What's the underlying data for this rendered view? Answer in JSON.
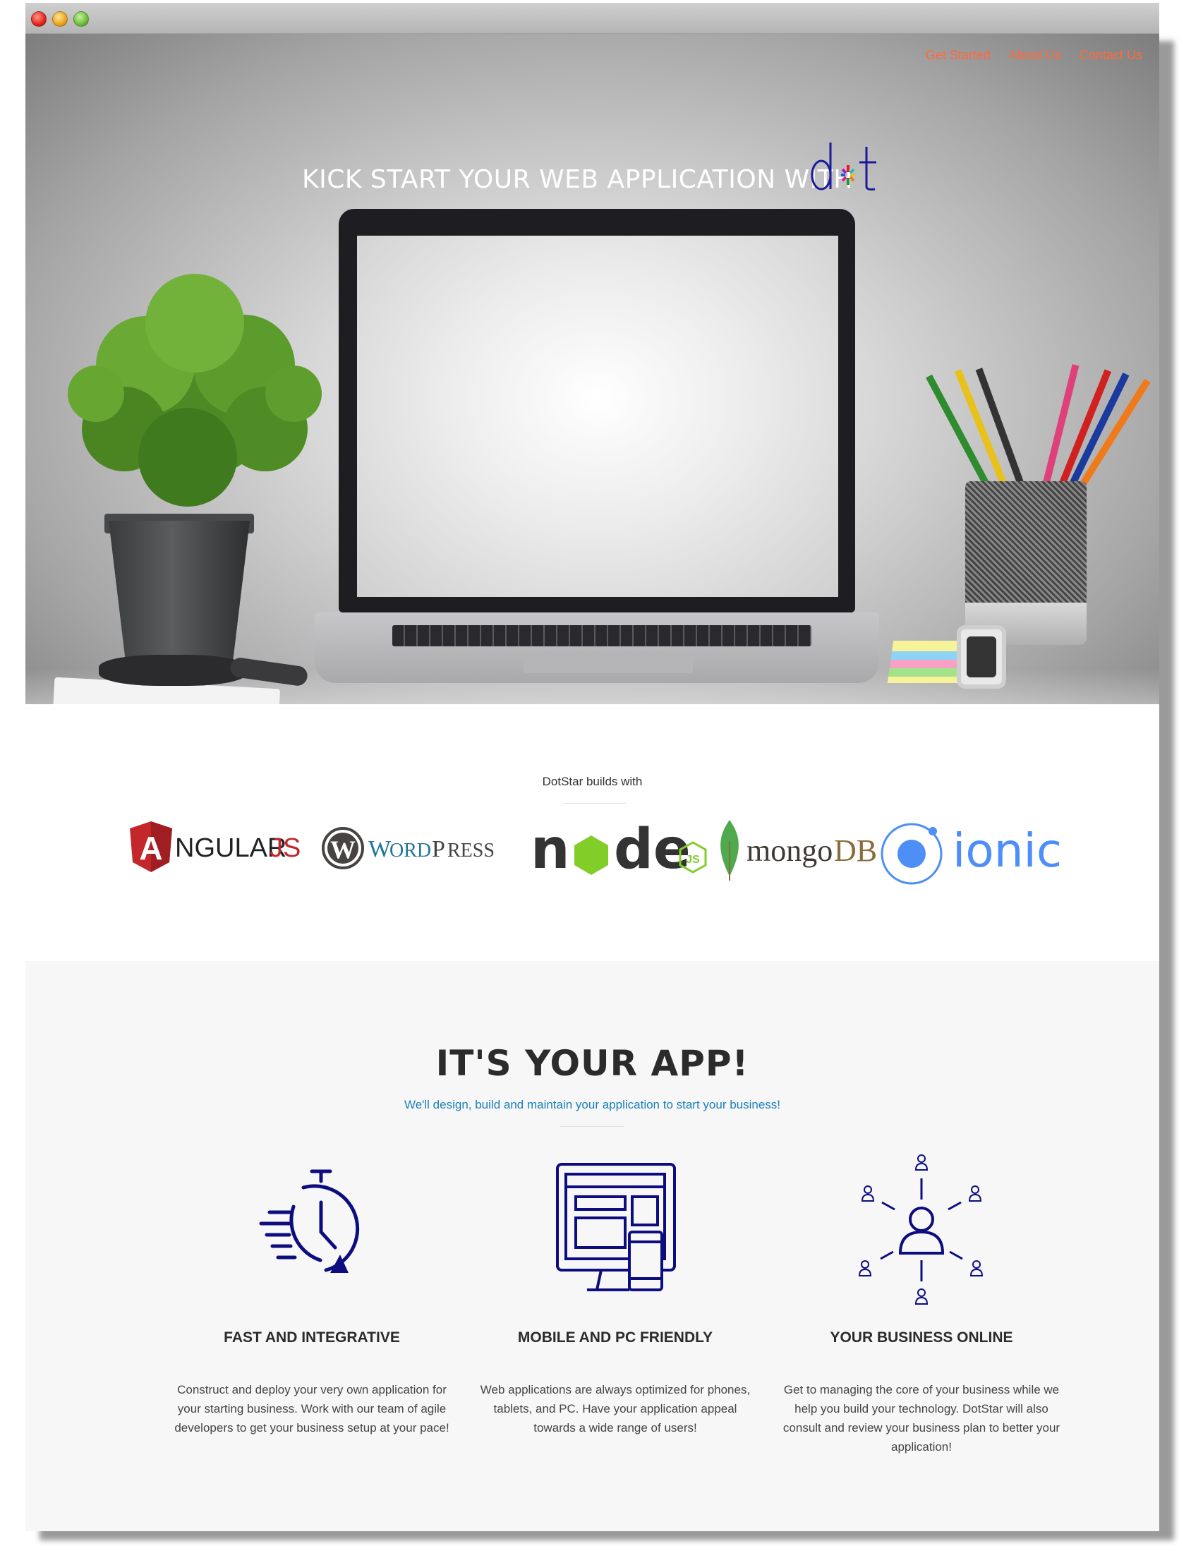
{
  "nav": {
    "items": [
      {
        "label": "Get Started"
      },
      {
        "label": "About Us"
      },
      {
        "label": "Contact Us"
      }
    ],
    "color": "#ff6a3d"
  },
  "hero": {
    "title": "KICK START YOUR WEB APPLICATION WITH",
    "logo_text": "dot"
  },
  "tech": {
    "label": "DotStar builds with",
    "logos": [
      "ANGULARJS",
      "WORDPRESS",
      "node",
      "mongoDB",
      "ionic"
    ]
  },
  "app": {
    "title": "IT'S YOUR APP!",
    "subtitle": "We'll design, build and maintain your application to start your business!",
    "features": [
      {
        "icon": "fast-clock-icon",
        "title": "FAST AND INTEGRATIVE",
        "text": "Construct and deploy your very own application for your starting business. Work with our team of agile developers to get your business setup at your pace!"
      },
      {
        "icon": "devices-icon",
        "title": "MOBILE AND PC FRIENDLY",
        "text": "Web applications are always optimized for phones, tablets, and PC. Have your application appeal towards a wide range of users!"
      },
      {
        "icon": "network-user-icon",
        "title": "YOUR BUSINESS ONLINE",
        "text": "Get to managing the core of your business while we help you build your technology. DotStar will also consult and review your business plan to better your application!"
      }
    ]
  },
  "colors": {
    "icon": "#0d0d80",
    "subtitle": "#1a7fb8"
  }
}
